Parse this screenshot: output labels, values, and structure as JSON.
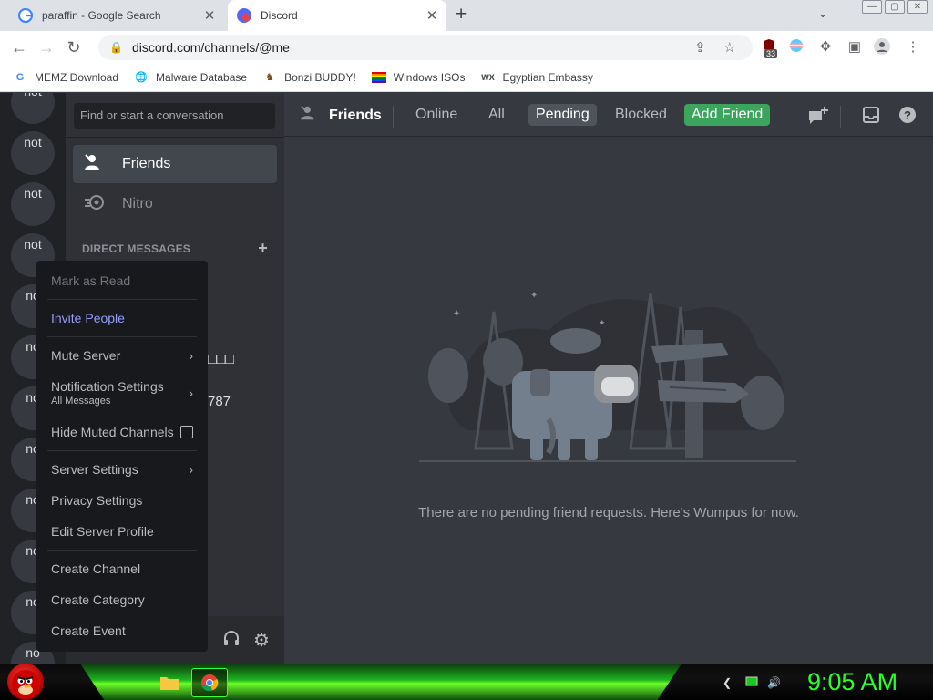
{
  "browser": {
    "tabs": [
      {
        "title": "paraffin - Google Search"
      },
      {
        "title": "Discord"
      }
    ],
    "new_tab": "+",
    "tab_search": "⌄",
    "window_controls": [
      "—",
      "▢",
      "✕"
    ],
    "url": "discord.com/channels/@me",
    "extension_badge": "33",
    "bookmarks": [
      {
        "label": "MEMZ Download"
      },
      {
        "label": "Malware Database"
      },
      {
        "label": "Bonzi BUDDY!"
      },
      {
        "label": "Windows ISOs"
      },
      {
        "label": "Egyptian Embassy"
      }
    ]
  },
  "discord": {
    "guilds": [
      "not",
      "not",
      "not",
      "not",
      "no",
      "no",
      "no",
      "no",
      "no",
      "no",
      "no",
      "no"
    ],
    "search_placeholder": "Find or start a conversation",
    "nav": {
      "friends": "Friends",
      "nitro": "Nitro"
    },
    "dm_header": "DIRECT MESSAGES",
    "dm_add": "+",
    "dm_fragments": [
      "□□□",
      "787"
    ],
    "topbar": {
      "title": "Friends",
      "tabs": [
        "Online",
        "All",
        "Pending",
        "Blocked"
      ],
      "selected_tab": "Pending",
      "add_friend": "Add Friend"
    },
    "empty_message": "There are no pending friend requests. Here's Wumpus for now.",
    "context_menu": {
      "mark_as_read": "Mark as Read",
      "invite_people": "Invite People",
      "mute_server": "Mute Server",
      "notification_settings": "Notification Settings",
      "notification_value": "All Messages",
      "hide_muted_channels": "Hide Muted Channels",
      "server_settings": "Server Settings",
      "privacy_settings": "Privacy Settings",
      "edit_server_profile": "Edit Server Profile",
      "create_channel": "Create Channel",
      "create_category": "Create Category",
      "create_event": "Create Event"
    }
  },
  "taskbar": {
    "clock": "9:05 AM"
  },
  "colors": {
    "discord_bg": "#36393f",
    "sidebar_bg": "#2f3136",
    "guilds_bg": "#202225",
    "accent_blurple": "#949cf7",
    "add_friend_green": "#3ba55d",
    "clock_green": "#2bff2b"
  }
}
